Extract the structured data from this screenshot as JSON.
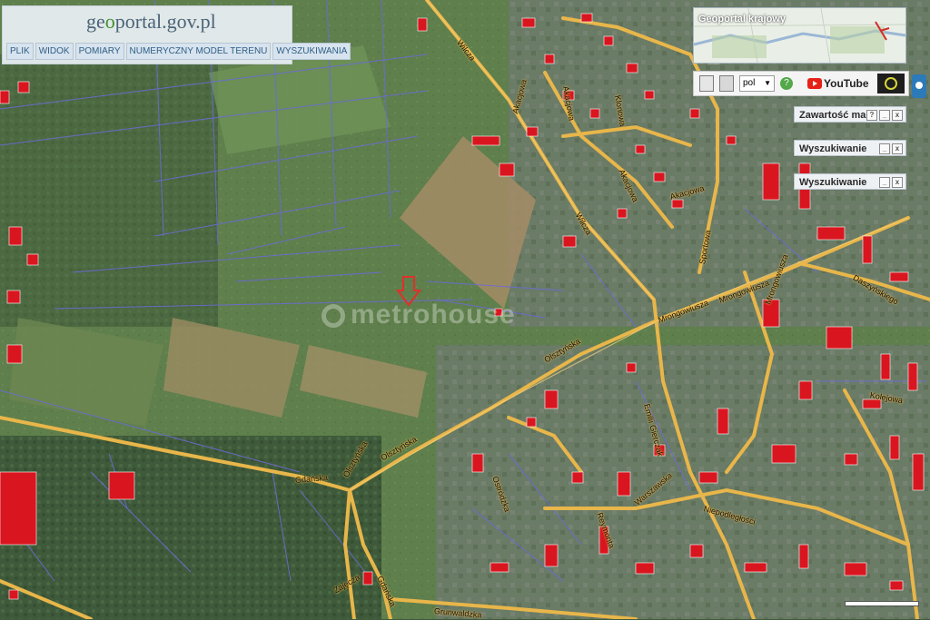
{
  "header": {
    "logo_text": "geoportal.gov.pl",
    "logo_prefix": "ge",
    "logo_leaf": "o",
    "logo_rest": "portal",
    "logo_suffix": ".gov.pl"
  },
  "menu": [
    {
      "label": "PLIK"
    },
    {
      "label": "WIDOK"
    },
    {
      "label": "POMIARY"
    },
    {
      "label": "NUMERYCZNY MODEL TERENU"
    },
    {
      "label": "WYSZUKIWANIA"
    }
  ],
  "overview_map": {
    "title": "Geoportal krajowy"
  },
  "toolbar": {
    "language": "pol",
    "youtube_label": "YouTube",
    "icons": [
      "document-icon",
      "print-icon",
      "help-icon",
      "youtube-icon",
      "eye-icon"
    ]
  },
  "panels": [
    {
      "title": "Zawartość mapy",
      "buttons": [
        "?",
        "_",
        "x"
      ]
    },
    {
      "title": "Wyszukiwanie",
      "buttons": [
        "_",
        "x"
      ]
    },
    {
      "title": "Wyszukiwanie",
      "buttons": [
        "_",
        "x"
      ]
    }
  ],
  "watermark": "metrohouse",
  "streets": [
    "Wilcza",
    "Akacjowa",
    "Akacjowa",
    "Klonowa",
    "Akacjowa",
    "Akacjowa",
    "Wilcza",
    "Sportowa",
    "Mrongowiusza",
    "Mrongowiusza",
    "Mrongowiusza",
    "Daszyńskiego",
    "Olsztyńska",
    "Emilii Gierczak",
    "Gdańska",
    "Olsztyńska",
    "Olsztyńska",
    "Ostródzka",
    "Warszawska",
    "Niepodległości",
    "Kolejowa",
    "Gdańska",
    "Grunwaldzka",
    "Zajęcza",
    "Reymonta"
  ],
  "colors": {
    "road": "#e8b64a",
    "parcel_border": "#6b6bd6",
    "building": "#d9161f",
    "menu_text": "#2f5f86"
  }
}
